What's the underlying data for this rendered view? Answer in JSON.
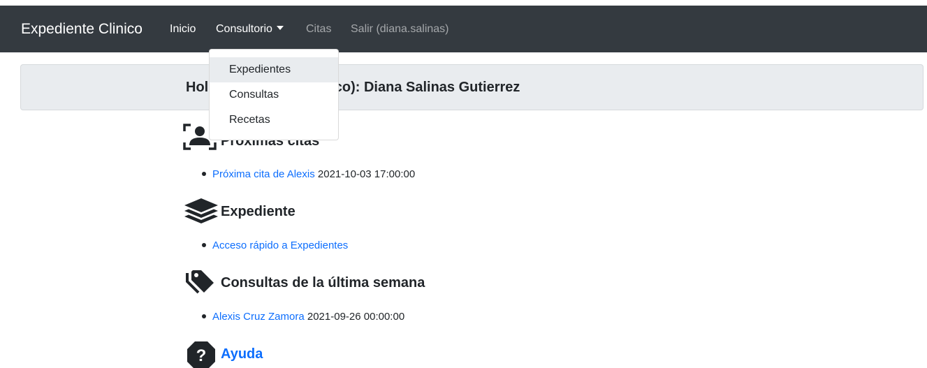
{
  "navbar": {
    "brand": "Expediente Clinico",
    "links": {
      "inicio": "Inicio",
      "consultorio": "Consultorio",
      "citas": "Citas",
      "salir": "Salir (diana.salinas)"
    },
    "colors": {
      "background": "#343a40",
      "active": "#ffffff",
      "muted": "#9a9da0"
    }
  },
  "dropdown": {
    "items": [
      "Expedientes",
      "Consultas",
      "Recetas"
    ],
    "hovered_item": "Expedientes"
  },
  "header": {
    "greeting": "Hola (Médico): Diana Salinas Gutierrez",
    "visible_prefix": "Hol",
    "visible_suffix": "ico): Diana Salinas Gutierrez"
  },
  "sections": {
    "citas": {
      "title": "Próximas citas",
      "icon": "portrait-icon",
      "item_link": "Próxima cita de Alexis",
      "item_text": "2021-10-03 17:00:00"
    },
    "expediente": {
      "title": "Expediente",
      "icon": "layers-icon",
      "item_link": "Acceso rápido a Expedientes"
    },
    "consultas": {
      "title": "Consultas de la última semana",
      "icon": "tags-icon",
      "item_link": "Alexis Cruz Zamora",
      "item_text": "2021-09-26 00:00:00"
    },
    "ayuda": {
      "title": "Ayuda",
      "icon": "question-icon"
    }
  },
  "colors": {
    "link": "#0d6efd",
    "jumbotron": "#e9ecef"
  }
}
